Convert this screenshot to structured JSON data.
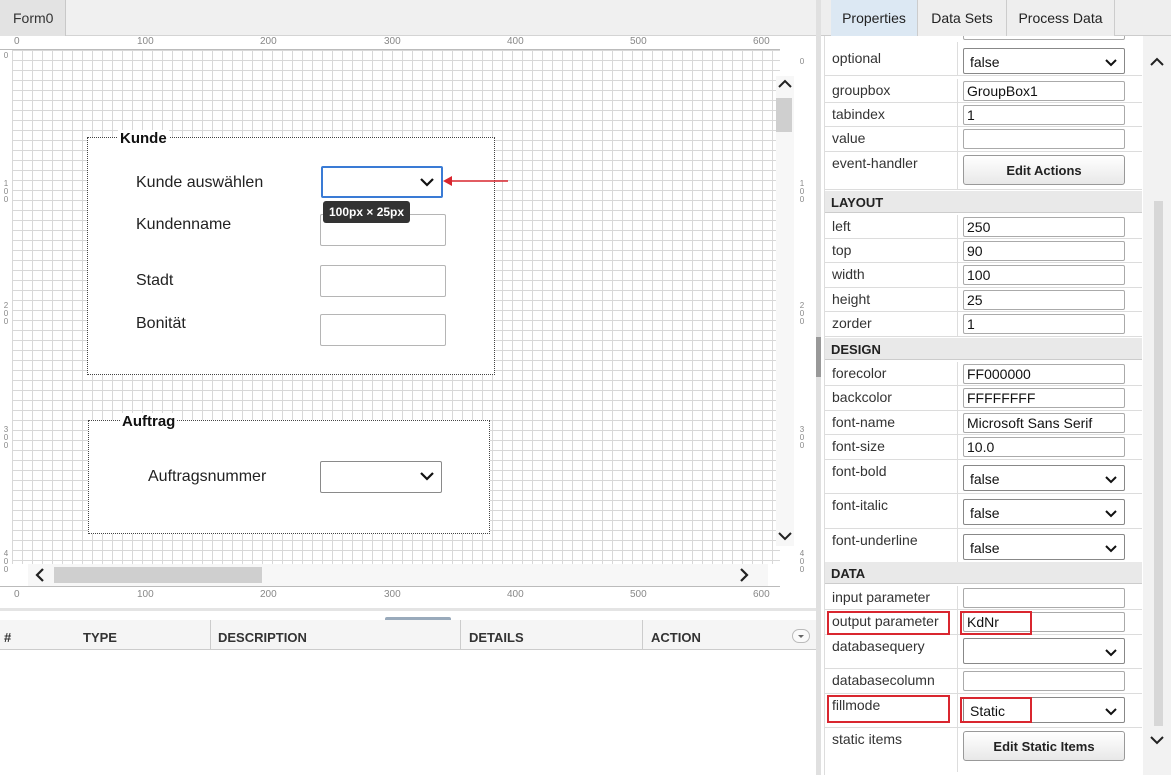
{
  "designer": {
    "form_tab": "Form0",
    "ruler_top_labels": [
      "0",
      "100",
      "200",
      "300",
      "400",
      "500",
      "600"
    ],
    "ruler_side_labels": [
      "0",
      "1\n0\n0",
      "2\n0\n0",
      "3\n0\n0",
      "4\n0\n0"
    ],
    "groupbox_kunde": {
      "title": "Kunde",
      "fields": [
        "Kunde auswählen",
        "Kundenname",
        "Stadt",
        "Bonität"
      ]
    },
    "groupbox_auftrag": {
      "title": "Auftrag",
      "fields": [
        "Auftragsnummer"
      ]
    },
    "size_tooltip": "100px × 25px"
  },
  "messages_table": {
    "columns": [
      "#",
      "TYPE",
      "DESCRIPTION",
      "DETAILS",
      "ACTION"
    ]
  },
  "right_panel": {
    "tabs": [
      "Properties",
      "Data Sets",
      "Process Data"
    ],
    "active_tab": "Properties",
    "rows": {
      "optional": {
        "name": "optional",
        "value": "false"
      },
      "groupbox": {
        "name": "groupbox",
        "value": "GroupBox1"
      },
      "tabindex": {
        "name": "tabindex",
        "value": "1"
      },
      "value": {
        "name": "value",
        "value": ""
      },
      "event_handler": {
        "name": "event-handler",
        "button": "Edit Actions"
      }
    },
    "layout": {
      "section": "LAYOUT",
      "left": {
        "name": "left",
        "value": "250"
      },
      "top": {
        "name": "top",
        "value": "90"
      },
      "width": {
        "name": "width",
        "value": "100"
      },
      "height": {
        "name": "height",
        "value": "25"
      },
      "zorder": {
        "name": "zorder",
        "value": "1"
      }
    },
    "design": {
      "section": "DESIGN",
      "forecolor": {
        "name": "forecolor",
        "value": "FF000000"
      },
      "backcolor": {
        "name": "backcolor",
        "value": "FFFFFFFF"
      },
      "font_name": {
        "name": "font-name",
        "value": "Microsoft Sans Serif"
      },
      "font_size": {
        "name": "font-size",
        "value": "10.0"
      },
      "font_bold": {
        "name": "font-bold",
        "value": "false"
      },
      "font_italic": {
        "name": "font-italic",
        "value": "false"
      },
      "font_underline": {
        "name": "font-underline",
        "value": "false"
      }
    },
    "data": {
      "section": "DATA",
      "input_parameter": {
        "name": "input parameter",
        "value": ""
      },
      "output_parameter": {
        "name": "output parameter",
        "value": "KdNr"
      },
      "databasequery": {
        "name": "databasequery",
        "value": ""
      },
      "databasecolumn": {
        "name": "databasecolumn",
        "value": ""
      },
      "fillmode": {
        "name": "fillmode",
        "value": "Static"
      },
      "static_items": {
        "name": "static items",
        "button": "Edit Static Items"
      }
    }
  },
  "colors": {
    "highlight_red": "#d9262f",
    "arrow_red": "#d9262f",
    "selected_blue": "#3a7bd5",
    "active_tab": "#dce8f3"
  },
  "icons": [
    "chevron-down-icon",
    "chevron-up-icon",
    "chevron-left-icon",
    "chevron-right-icon",
    "arrow-icon"
  ]
}
